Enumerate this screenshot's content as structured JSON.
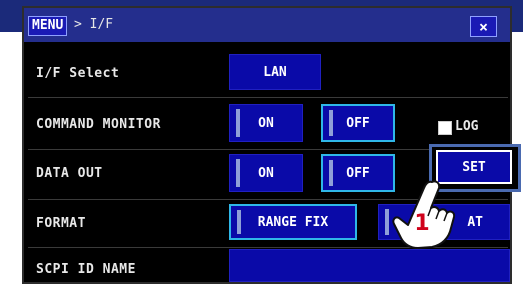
{
  "header": {
    "menu_tag": "MENU",
    "breadcrumb": "> I/F",
    "close_label": "×"
  },
  "rows": {
    "if_select": {
      "label": "I/F Select",
      "value": "LAN"
    },
    "command_monitor": {
      "label": "COMMAND MONITOR",
      "on": "ON",
      "off": "OFF",
      "log_label": "LOG"
    },
    "data_out": {
      "label": "DATA OUT",
      "on": "ON",
      "off": "OFF",
      "set": "SET"
    },
    "format": {
      "label": "FORMAT",
      "range_fix": "RANGE FIX",
      "second_option": "AT"
    },
    "scpi": {
      "label": "SCPI ID NAME",
      "value": ""
    }
  },
  "callout": {
    "number": "1"
  },
  "colors": {
    "panel_bg": "#000000",
    "button_bg": "#0a0aa8",
    "selected_border": "#2fb7e8",
    "header_bg": "#242e8d",
    "callout_red": "#d0021b"
  }
}
